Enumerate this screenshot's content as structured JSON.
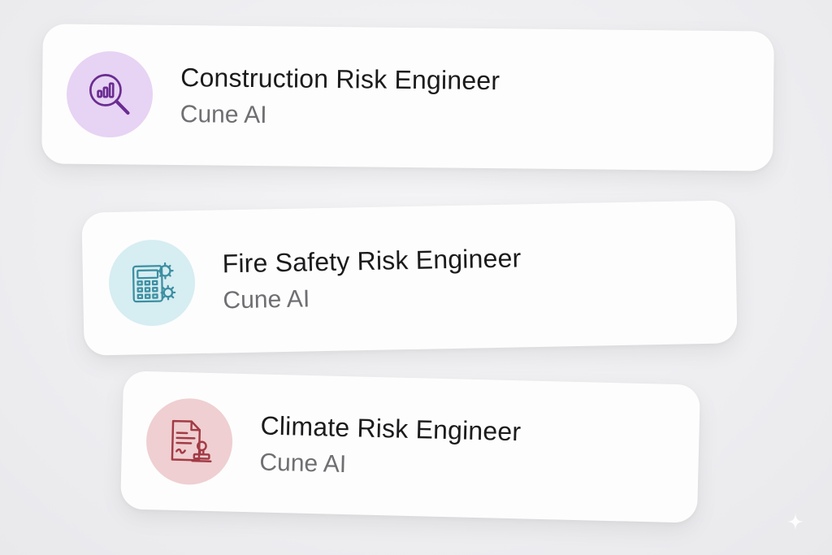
{
  "cards": [
    {
      "title": "Construction Risk Engineer",
      "subtitle": "Cune AI",
      "icon": "chart-magnifier-icon",
      "icon_bg": "#e7d3f3",
      "icon_color": "#6a2c91"
    },
    {
      "title": "Fire Safety Risk Engineer",
      "subtitle": "Cune AI",
      "icon": "calculator-gear-icon",
      "icon_bg": "#d6edf2",
      "icon_color": "#3c8fa1"
    },
    {
      "title": "Climate Risk Engineer",
      "subtitle": "Cune AI",
      "icon": "document-stamp-icon",
      "icon_bg": "#efcfd1",
      "icon_color": "#a23b45"
    }
  ],
  "watermark_icon": "sparkle-icon"
}
